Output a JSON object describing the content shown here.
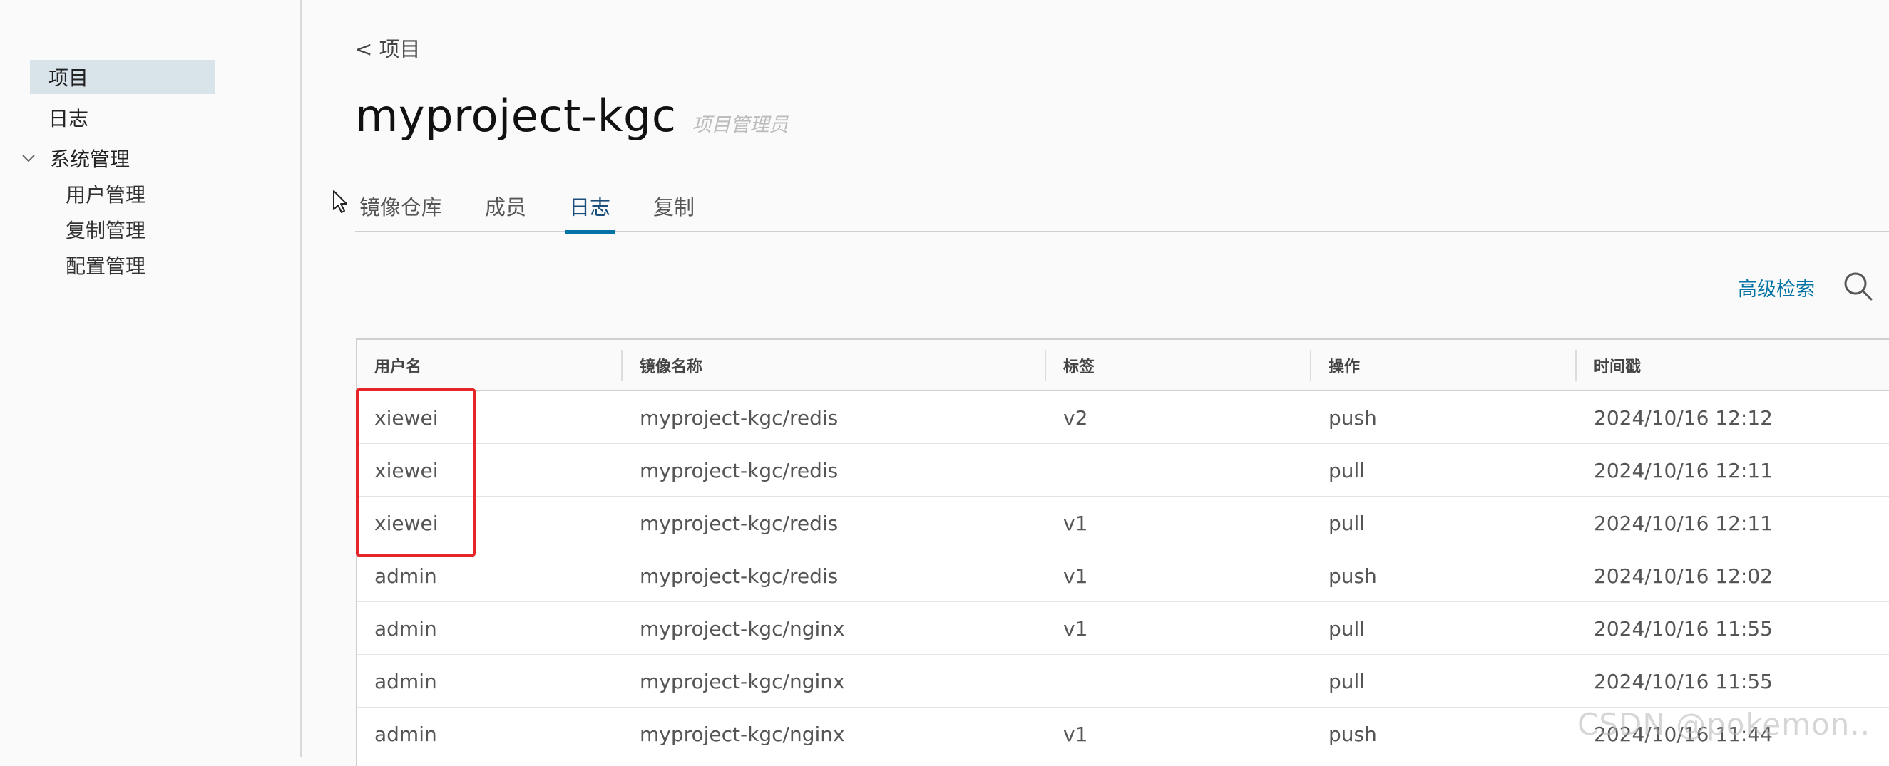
{
  "sidebar": {
    "items": [
      {
        "label": "项目"
      },
      {
        "label": "日志"
      }
    ],
    "group": {
      "label": "系统管理",
      "children": [
        {
          "label": "用户管理"
        },
        {
          "label": "复制管理"
        },
        {
          "label": "配置管理"
        }
      ]
    }
  },
  "header": {
    "breadcrumb": "< 项目",
    "title": "myproject-kgc",
    "role": "项目管理员"
  },
  "tabs": [
    {
      "label": "镜像仓库"
    },
    {
      "label": "成员"
    },
    {
      "label": "日志"
    },
    {
      "label": "复制"
    }
  ],
  "toolbar": {
    "advanced_search": "高级检索"
  },
  "table": {
    "columns": [
      "用户名",
      "镜像名称",
      "标签",
      "操作",
      "时间戳"
    ],
    "rows": [
      [
        "xiewei",
        "myproject-kgc/redis",
        "v2",
        "push",
        "2024/10/16 12:12"
      ],
      [
        "xiewei",
        "myproject-kgc/redis",
        "",
        "pull",
        "2024/10/16 12:11"
      ],
      [
        "xiewei",
        "myproject-kgc/redis",
        "v1",
        "pull",
        "2024/10/16 12:11"
      ],
      [
        "admin",
        "myproject-kgc/redis",
        "v1",
        "push",
        "2024/10/16 12:02"
      ],
      [
        "admin",
        "myproject-kgc/nginx",
        "v1",
        "pull",
        "2024/10/16 11:55"
      ],
      [
        "admin",
        "myproject-kgc/nginx",
        "",
        "pull",
        "2024/10/16 11:55"
      ],
      [
        "admin",
        "myproject-kgc/nginx",
        "v1",
        "push",
        "2024/10/16 11:44"
      ]
    ]
  },
  "watermark": "CSDN @pokemon..",
  "colors": {
    "accent": "#0072a3",
    "highlight": "#e4262b",
    "active_nav": "#d8e3ea"
  }
}
